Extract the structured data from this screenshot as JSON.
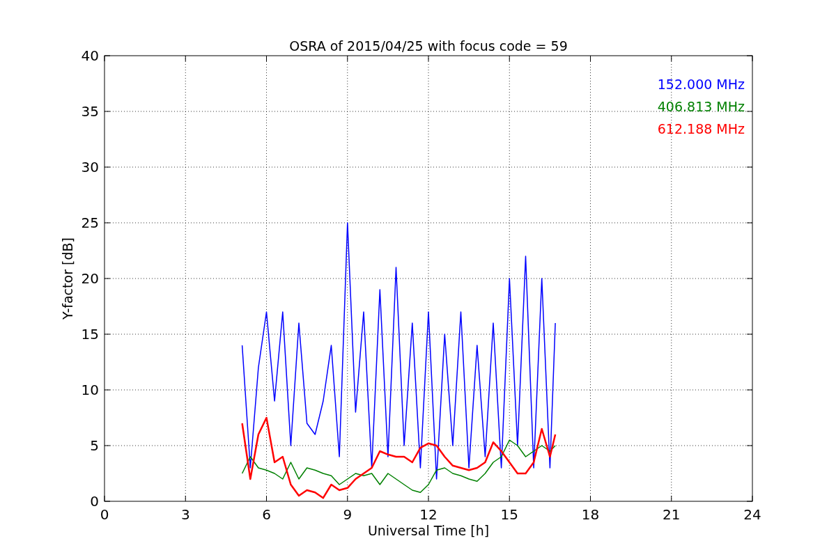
{
  "figure": {
    "chart_data": {
      "type": "line",
      "title": "OSRA of 2015/04/25 with focus code = 59",
      "xlabel": "Universal Time [h]",
      "ylabel": "Y-factor [dB]",
      "x": [
        5.1,
        5.4,
        5.7,
        6.0,
        6.3,
        6.6,
        6.9,
        7.2,
        7.5,
        7.8,
        8.1,
        8.4,
        8.7,
        9.0,
        9.3,
        9.6,
        9.9,
        10.2,
        10.5,
        10.8,
        11.1,
        11.4,
        11.7,
        12.0,
        12.3,
        12.6,
        12.9,
        13.2,
        13.5,
        13.8,
        14.1,
        14.4,
        14.7,
        15.0,
        15.3,
        15.6,
        15.9,
        16.2,
        16.5,
        16.7
      ],
      "series": [
        {
          "name": "152.000 MHz",
          "color": "#0000ff",
          "values": [
            14,
            3,
            12,
            17,
            9,
            17,
            5,
            16,
            7,
            6,
            9,
            14,
            4,
            25,
            8,
            17,
            3,
            19,
            4,
            21,
            5,
            16,
            3,
            17,
            2,
            15,
            5,
            17,
            3,
            14,
            4,
            16,
            3,
            20,
            5,
            22,
            3,
            20,
            3,
            16
          ]
        },
        {
          "name": "406.813 MHz",
          "color": "#008000",
          "values": [
            2.5,
            4,
            3,
            2.8,
            2.5,
            2,
            3.5,
            2,
            3,
            2.8,
            2.5,
            2.3,
            1.5,
            2,
            2.5,
            2.3,
            2.5,
            1.5,
            2.5,
            2,
            1.5,
            1,
            0.8,
            1.5,
            2.8,
            3,
            2.5,
            2.3,
            2,
            1.8,
            2.5,
            3.5,
            4,
            5.5,
            5,
            4,
            4.5,
            5,
            4.5,
            5
          ]
        },
        {
          "name": "612.188 MHz",
          "color": "#ff0000",
          "values": [
            7,
            2,
            6,
            7.5,
            3.5,
            4,
            1.5,
            0.5,
            1,
            0.8,
            0.3,
            1.5,
            1,
            1.2,
            2,
            2.5,
            3,
            4.5,
            4.2,
            4,
            4,
            3.5,
            4.8,
            5.2,
            5,
            4,
            3.2,
            3,
            2.8,
            3,
            3.5,
            5.3,
            4.5,
            3.5,
            2.5,
            2.5,
            3.5,
            6.5,
            4,
            6
          ]
        }
      ],
      "grid": true,
      "xlim": [
        0,
        24
      ],
      "ylim": [
        0,
        40
      ],
      "xticks": [
        0,
        3,
        6,
        9,
        12,
        15,
        18,
        21,
        24
      ],
      "yticks": [
        0,
        5,
        10,
        15,
        20,
        25,
        30,
        35,
        40
      ]
    }
  }
}
